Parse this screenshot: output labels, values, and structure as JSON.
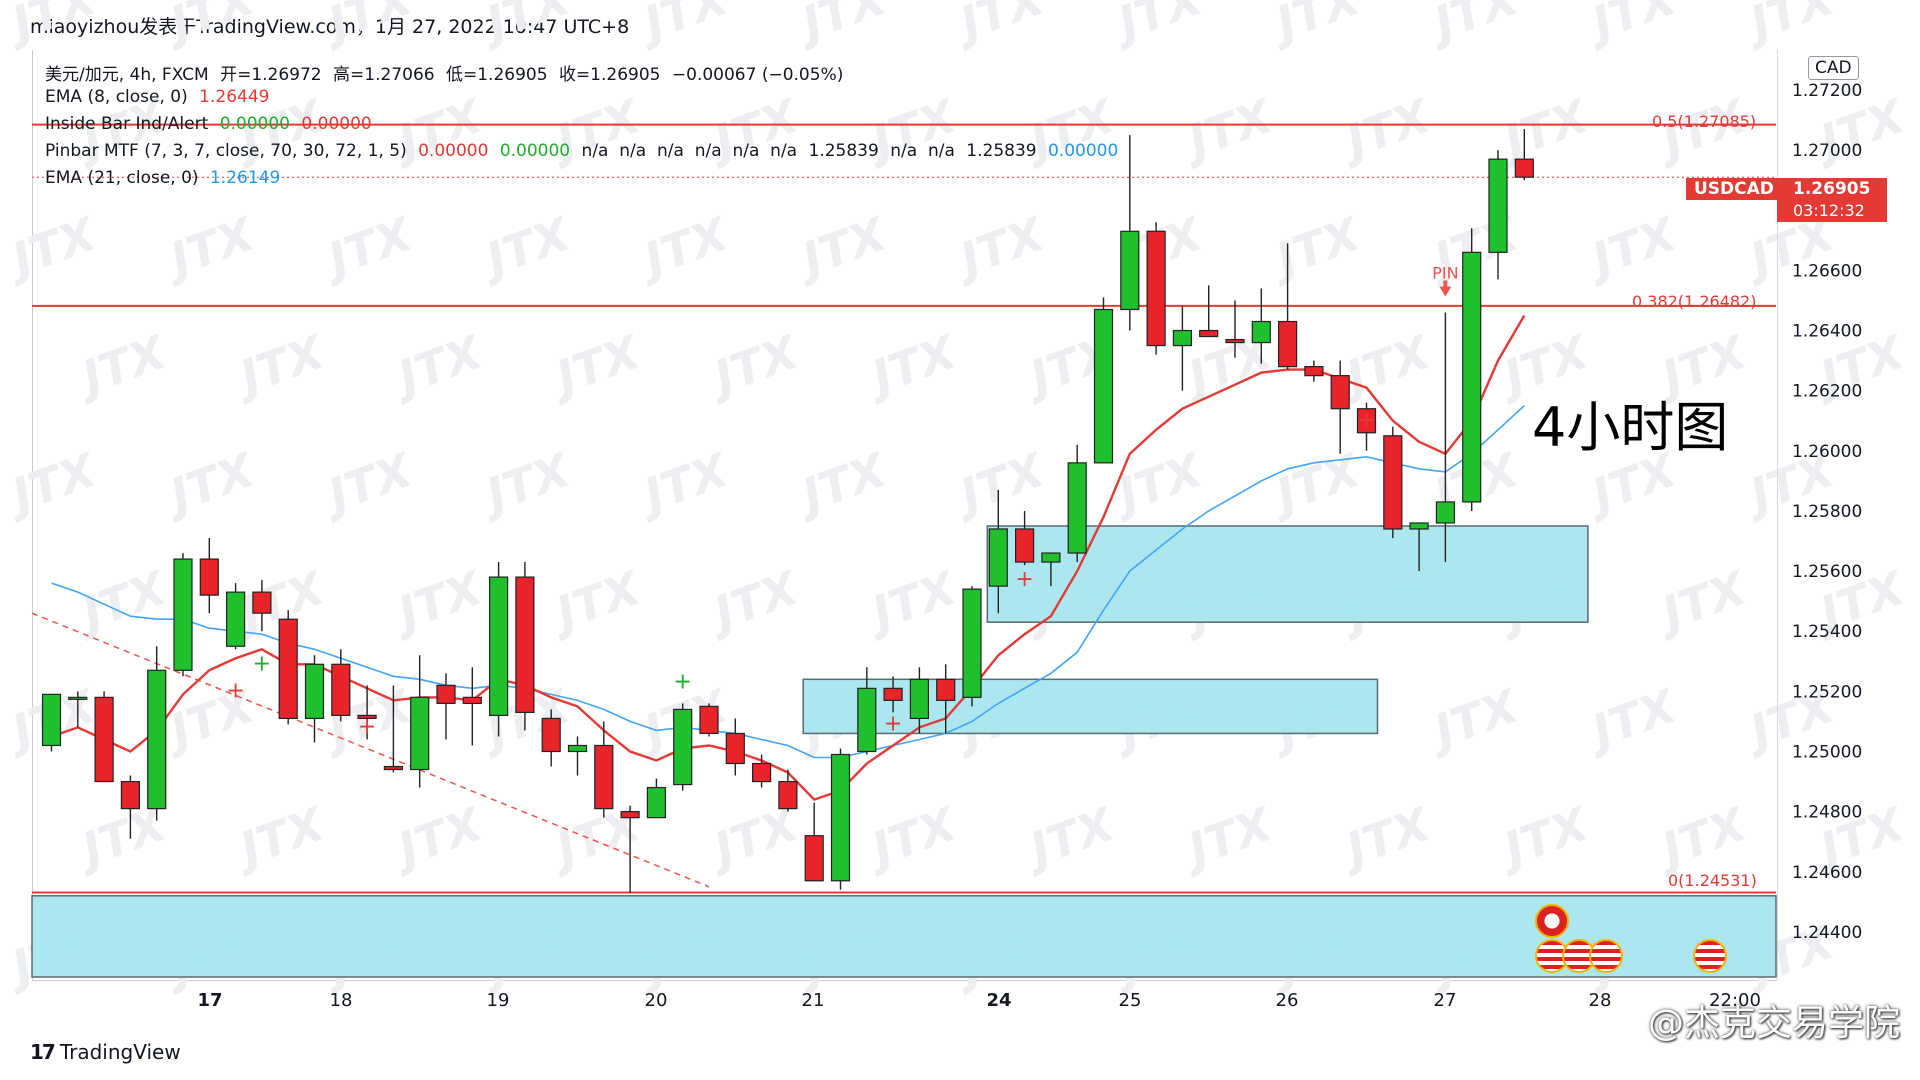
{
  "header": {
    "title_line": "miaoyizhou发表于TradingView.com，1月 27, 2022 10:47 UTC+8"
  },
  "legend": {
    "main": {
      "symbol": "美元/加元, 4h, FXCM",
      "open": "开=1.26972",
      "high": "高=1.27066",
      "low": "低=1.26905",
      "close": "收=1.26905",
      "change": "−0.00067 (−0.05%)"
    },
    "ema8": {
      "label": "EMA (8, close, 0)",
      "value": "1.26449"
    },
    "inside_bar": {
      "label": "Inside Bar Ind/Alert",
      "v1": "0.00000",
      "v2": "0.00000"
    },
    "pinbar": {
      "label": "Pinbar MTF (7, 3, 7, close, 70, 30, 72, 1, 5)",
      "v1": "0.00000",
      "v2": "0.00000",
      "na_run": "n/a  n/a  n/a  n/a  n/a  n/a",
      "v3": "1.25839",
      "na_run2": "n/a  n/a",
      "v4": "1.25839",
      "v5": "0.00000"
    },
    "ema21": {
      "label": "EMA (21, close, 0)",
      "value": "1.26149"
    }
  },
  "price_axis": {
    "currency": "CAD",
    "ticks": [
      "1.27200",
      "1.27000",
      "1.26600",
      "1.26400",
      "1.26200",
      "1.26000",
      "1.25800",
      "1.25600",
      "1.25400",
      "1.25200",
      "1.25000",
      "1.24800",
      "1.24600",
      "1.24400"
    ],
    "symbol_tag": "USDCAD",
    "last_price": "1.26905",
    "countdown": "03:12:32"
  },
  "fib": {
    "level_05": "0.5(1.27085)",
    "level_0382": "0.382(1.26482)",
    "level_0": "0(1.24531)"
  },
  "annotations": {
    "pin_label": "PIN",
    "big_text": "4小时图"
  },
  "footer": {
    "brand": "TradingView",
    "logo_mark": "17",
    "watermark": "@杰克交易学院"
  },
  "colors": {
    "up": "#1fbf2e",
    "down": "#e8242b",
    "ema8": "#e53935",
    "ema21": "#42a5f5",
    "zone_fill": "#a8e6ef",
    "fib_line": "#e53935"
  },
  "chart_data": {
    "type": "candlestick",
    "title": "美元/加元, 4h, FXCM",
    "xlabel": "",
    "ylabel": "",
    "ylim": [
      1.2425,
      1.2735
    ],
    "x_tick_labels": [
      "17",
      "18",
      "19",
      "20",
      "21",
      "24",
      "25",
      "26",
      "27",
      "28",
      "22:00"
    ],
    "candles": [
      {
        "o": 1.2502,
        "h": 1.2519,
        "l": 1.25,
        "c": 1.2519
      },
      {
        "o": 1.2518,
        "h": 1.252,
        "l": 1.2508,
        "c": 1.2518
      },
      {
        "o": 1.2518,
        "h": 1.252,
        "l": 1.249,
        "c": 1.249
      },
      {
        "o": 1.249,
        "h": 1.2492,
        "l": 1.2471,
        "c": 1.2481
      },
      {
        "o": 1.2481,
        "h": 1.2535,
        "l": 1.2477,
        "c": 1.2527
      },
      {
        "o": 1.2527,
        "h": 1.2566,
        "l": 1.2525,
        "c": 1.2564
      },
      {
        "o": 1.2564,
        "h": 1.2571,
        "l": 1.2546,
        "c": 1.2552
      },
      {
        "o": 1.2535,
        "h": 1.2556,
        "l": 1.2534,
        "c": 1.2553
      },
      {
        "o": 1.2553,
        "h": 1.2557,
        "l": 1.254,
        "c": 1.2546
      },
      {
        "o": 1.2544,
        "h": 1.2547,
        "l": 1.2509,
        "c": 1.2511
      },
      {
        "o": 1.2511,
        "h": 1.2532,
        "l": 1.2503,
        "c": 1.2529
      },
      {
        "o": 1.2529,
        "h": 1.2534,
        "l": 1.251,
        "c": 1.2512
      },
      {
        "o": 1.2512,
        "h": 1.2522,
        "l": 1.2504,
        "c": 1.2511
      },
      {
        "o": 1.2495,
        "h": 1.2522,
        "l": 1.2493,
        "c": 1.2494
      },
      {
        "o": 1.2494,
        "h": 1.2532,
        "l": 1.2488,
        "c": 1.2518
      },
      {
        "o": 1.2522,
        "h": 1.2526,
        "l": 1.2504,
        "c": 1.2516
      },
      {
        "o": 1.2518,
        "h": 1.2528,
        "l": 1.2502,
        "c": 1.2516
      },
      {
        "o": 1.2512,
        "h": 1.2563,
        "l": 1.2505,
        "c": 1.2558
      },
      {
        "o": 1.2558,
        "h": 1.2563,
        "l": 1.2507,
        "c": 1.2513
      },
      {
        "o": 1.2511,
        "h": 1.2514,
        "l": 1.2495,
        "c": 1.25
      },
      {
        "o": 1.25,
        "h": 1.2505,
        "l": 1.2492,
        "c": 1.2502
      },
      {
        "o": 1.2502,
        "h": 1.251,
        "l": 1.2478,
        "c": 1.2481
      },
      {
        "o": 1.248,
        "h": 1.2482,
        "l": 1.2453,
        "c": 1.2478
      },
      {
        "o": 1.2478,
        "h": 1.2491,
        "l": 1.2478,
        "c": 1.2488
      },
      {
        "o": 1.2489,
        "h": 1.2516,
        "l": 1.2487,
        "c": 1.2514
      },
      {
        "o": 1.2515,
        "h": 1.2516,
        "l": 1.2505,
        "c": 1.2506
      },
      {
        "o": 1.2506,
        "h": 1.2511,
        "l": 1.2492,
        "c": 1.2496
      },
      {
        "o": 1.2496,
        "h": 1.2499,
        "l": 1.2488,
        "c": 1.249
      },
      {
        "o": 1.249,
        "h": 1.2494,
        "l": 1.248,
        "c": 1.2481
      },
      {
        "o": 1.2472,
        "h": 1.2483,
        "l": 1.2457,
        "c": 1.2457
      },
      {
        "o": 1.2457,
        "h": 1.2501,
        "l": 1.2454,
        "c": 1.2499
      },
      {
        "o": 1.25,
        "h": 1.2528,
        "l": 1.2499,
        "c": 1.2521
      },
      {
        "o": 1.2521,
        "h": 1.2525,
        "l": 1.2513,
        "c": 1.2517
      },
      {
        "o": 1.2511,
        "h": 1.2528,
        "l": 1.2506,
        "c": 1.2524
      },
      {
        "o": 1.2524,
        "h": 1.2529,
        "l": 1.2506,
        "c": 1.2517
      },
      {
        "o": 1.2518,
        "h": 1.2555,
        "l": 1.2515,
        "c": 1.2554
      },
      {
        "o": 1.2555,
        "h": 1.2587,
        "l": 1.2546,
        "c": 1.2574
      },
      {
        "o": 1.2574,
        "h": 1.258,
        "l": 1.2562,
        "c": 1.2563
      },
      {
        "o": 1.2563,
        "h": 1.2566,
        "l": 1.2555,
        "c": 1.2566
      },
      {
        "o": 1.2566,
        "h": 1.2602,
        "l": 1.2563,
        "c": 1.2596
      },
      {
        "o": 1.2596,
        "h": 1.2651,
        "l": 1.2596,
        "c": 1.2647
      },
      {
        "o": 1.2647,
        "h": 1.2705,
        "l": 1.264,
        "c": 1.2673
      },
      {
        "o": 1.2673,
        "h": 1.2676,
        "l": 1.2632,
        "c": 1.2635
      },
      {
        "o": 1.2635,
        "h": 1.2648,
        "l": 1.262,
        "c": 1.264
      },
      {
        "o": 1.264,
        "h": 1.2655,
        "l": 1.2638,
        "c": 1.2638
      },
      {
        "o": 1.2637,
        "h": 1.265,
        "l": 1.2631,
        "c": 1.2636
      },
      {
        "o": 1.2636,
        "h": 1.2654,
        "l": 1.2629,
        "c": 1.2643
      },
      {
        "o": 1.2643,
        "h": 1.2669,
        "l": 1.2627,
        "c": 1.2628
      },
      {
        "o": 1.2628,
        "h": 1.263,
        "l": 1.2623,
        "c": 1.2625
      },
      {
        "o": 1.2625,
        "h": 1.263,
        "l": 1.2599,
        "c": 1.2614
      },
      {
        "o": 1.2614,
        "h": 1.2616,
        "l": 1.26,
        "c": 1.2606
      },
      {
        "o": 1.2605,
        "h": 1.2608,
        "l": 1.2571,
        "c": 1.2574
      },
      {
        "o": 1.2574,
        "h": 1.2576,
        "l": 1.256,
        "c": 1.2576
      },
      {
        "o": 1.2576,
        "h": 1.2646,
        "l": 1.2563,
        "c": 1.2583
      },
      {
        "o": 1.2583,
        "h": 1.2674,
        "l": 1.258,
        "c": 1.2666
      },
      {
        "o": 1.2666,
        "h": 1.27,
        "l": 1.2657,
        "c": 1.2697
      },
      {
        "o": 1.2697,
        "h": 1.2707,
        "l": 1.269,
        "c": 1.2691
      }
    ],
    "ema8": [
      1.2505,
      1.2508,
      1.2504,
      1.25,
      1.2507,
      1.2519,
      1.2527,
      1.2531,
      1.2534,
      1.2529,
      1.2529,
      1.2525,
      1.2521,
      1.2517,
      1.2518,
      1.2518,
      1.2517,
      1.2524,
      1.2522,
      1.2518,
      1.2515,
      1.2507,
      1.25,
      1.2497,
      1.2501,
      1.2502,
      1.25,
      1.2497,
      1.2493,
      1.2484,
      1.2487,
      1.2496,
      1.2502,
      1.2508,
      1.2511,
      1.2521,
      1.2532,
      1.2539,
      1.2545,
      1.256,
      1.2578,
      1.2599,
      1.2607,
      1.2614,
      1.2618,
      1.2622,
      1.2626,
      1.2627,
      1.2627,
      1.2624,
      1.2621,
      1.261,
      1.2603,
      1.2599,
      1.261,
      1.263,
      1.2645
    ],
    "ema21": [
      1.2556,
      1.2553,
      1.2549,
      1.2545,
      1.2544,
      1.2544,
      1.2541,
      1.254,
      1.2539,
      1.2536,
      1.2534,
      1.2531,
      1.2528,
      1.2525,
      1.2524,
      1.2522,
      1.2521,
      1.2522,
      1.2521,
      1.2519,
      1.2517,
      1.2514,
      1.251,
      1.2507,
      1.2508,
      1.2507,
      1.2506,
      1.2504,
      1.2502,
      1.2498,
      1.2498,
      1.25,
      1.2502,
      1.2504,
      1.2506,
      1.251,
      1.2516,
      1.2521,
      1.2526,
      1.2533,
      1.2547,
      1.256,
      1.2567,
      1.2574,
      1.258,
      1.2585,
      1.259,
      1.2594,
      1.2596,
      1.2597,
      1.2598,
      1.2596,
      1.2594,
      1.2593,
      1.2599,
      1.2607,
      1.2615
    ],
    "zones": [
      {
        "from_bar": 36,
        "to_bar": 58,
        "low": 1.2543,
        "high": 1.2575
      },
      {
        "from_bar": 29,
        "to_bar": 50,
        "low": 1.2506,
        "high": 1.2524
      },
      {
        "from_bar": -1,
        "to_bar": 70,
        "low": 1.2425,
        "high": 1.2452
      }
    ],
    "fib_levels": [
      1.27085,
      1.26482,
      1.24531
    ],
    "trendline": {
      "from_bar": -1,
      "from_price": 1.2546,
      "to_bar": 25,
      "to_price": 1.2455
    },
    "pin_bar_index": 53,
    "plus_markers": [
      {
        "bar": 8,
        "price": 1.2527,
        "color": "green"
      },
      {
        "bar": 7,
        "price": 1.2518,
        "color": "red"
      },
      {
        "bar": 12,
        "price": 1.2506,
        "color": "red"
      },
      {
        "bar": 24,
        "price": 1.2521,
        "color": "green"
      },
      {
        "bar": 32,
        "price": 1.2507,
        "color": "red"
      },
      {
        "bar": 37,
        "price": 1.2555,
        "color": "red"
      },
      {
        "bar": 50,
        "price": 1.2608,
        "color": "red"
      }
    ]
  }
}
